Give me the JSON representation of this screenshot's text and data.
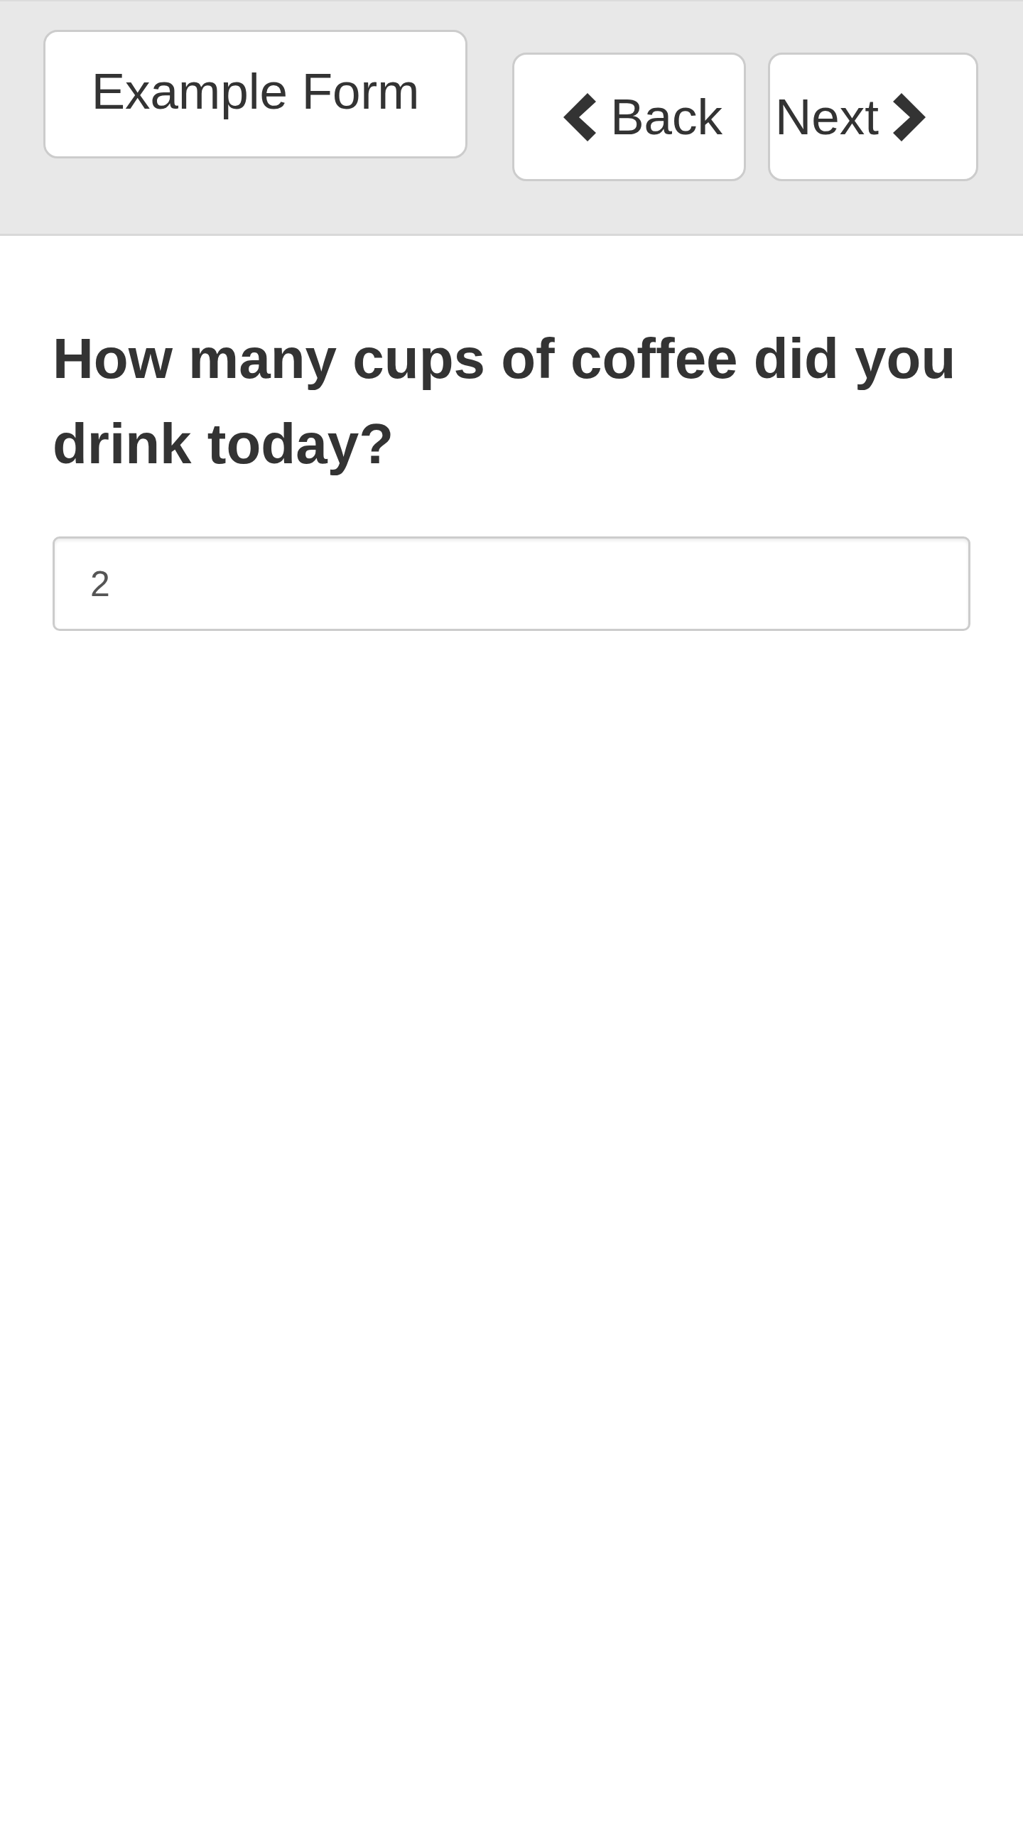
{
  "header": {
    "title_button": "Example Form",
    "nav_buttons": [
      {
        "kind": "back",
        "label": "Back"
      },
      {
        "kind": "next",
        "label": "Next"
      }
    ]
  },
  "question": {
    "text": "How many cups of coffee did you drink today?",
    "answer": {
      "value": "2"
    }
  }
}
